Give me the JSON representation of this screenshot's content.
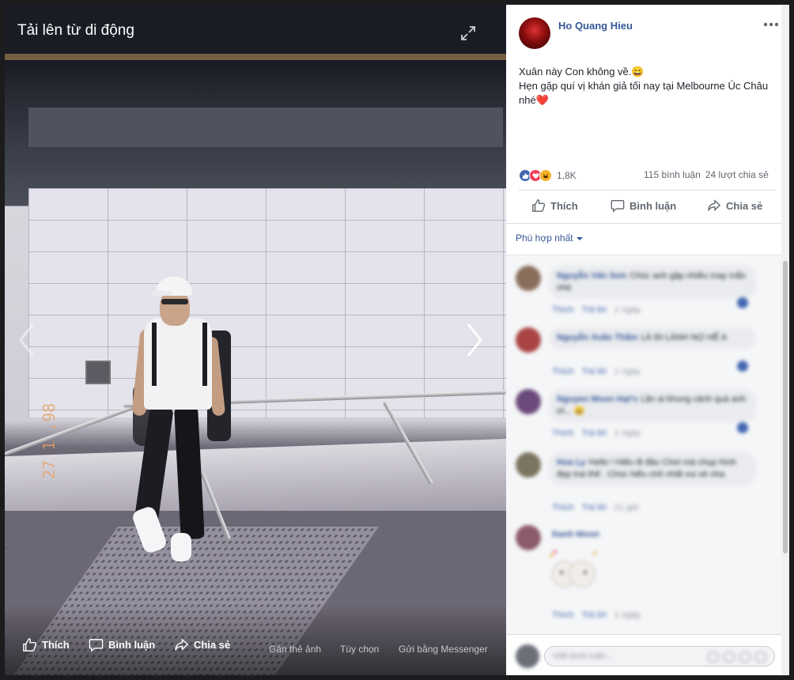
{
  "viewer": {
    "title": "Tải lên từ di động",
    "photo_date_stamp": "27 1 ,98",
    "actions": {
      "like": "Thích",
      "comment": "Bình luận",
      "share": "Chia sẻ",
      "tag": "Gắn thẻ ảnh",
      "options": "Tùy chọn",
      "send": "Gửi bằng Messenger"
    }
  },
  "post": {
    "author": "Ho Quang Hieu",
    "text_line1": "Xuân này Con không về.😄",
    "text_line2": "Hẹn gặp quí vị khán giả tối nay tại Melbourne Úc Châu nhé❤️",
    "reaction_count": "1,8K",
    "comment_count": "115 bình luận",
    "share_count": "24 lượt chia sẻ",
    "actions": {
      "like": "Thích",
      "comment": "Bình luận",
      "share": "Chia sẻ"
    },
    "sort_label": "Phù hợp nhất"
  },
  "comments": [
    {
      "name": "Nguyễn Văn Sơn",
      "text": "Chúc anh gặp nhiều may mắn nhé",
      "like": "Thích",
      "reply": "Trả lời",
      "time": "1 ngày"
    },
    {
      "name": "Nguyễn Xuân Thắm",
      "text": "LÀ ĐI LÀNH NỢ HẾ A",
      "like": "Thích",
      "reply": "Trả lời",
      "time": "1 ngày"
    },
    {
      "name": "Nguyen Moon Hạt's",
      "text": "Lần ai khung cảnh quá anh ơi... 😄",
      "like": "Thích",
      "reply": "Trả lời",
      "time": "1 ngày"
    },
    {
      "name": "Hoa Ly",
      "text": "Hello ! Hiếu đi đâu Chơi mà chụp hình đẹp trai thế . Chúc hiếu chỏ nhất vui vẻ nha",
      "like": "Thích",
      "reply": "Trả lời",
      "time": "21 giờ"
    },
    {
      "name": "Danh Moon",
      "text": "",
      "like": "Thích",
      "reply": "Trả lời",
      "time": "1 ngày"
    }
  ],
  "composer": {
    "placeholder": "Viết bình luận..."
  },
  "colors": {
    "link_blue": "#365899",
    "like_blue": "#4267b2",
    "love_red": "#f33e58",
    "haha_yellow": "#f7b125"
  }
}
